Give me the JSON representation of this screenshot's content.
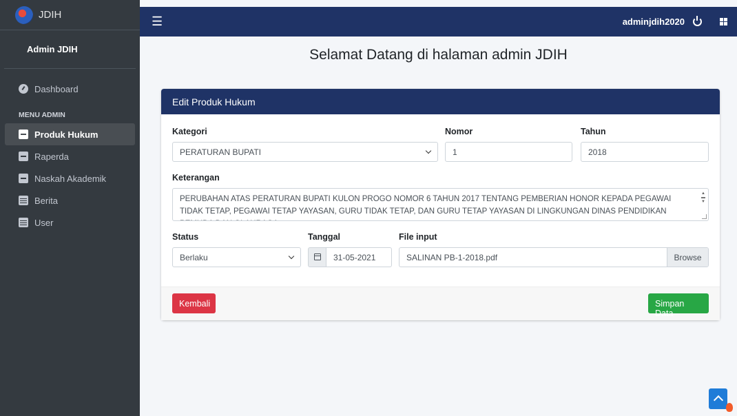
{
  "brand": {
    "title": "JDIH"
  },
  "user_panel": {
    "name": "Admin JDIH"
  },
  "sidebar": {
    "dashboard": "Dashboard",
    "header": "MENU ADMIN",
    "items": [
      {
        "label": "Produk Hukum",
        "icon": "document-icon",
        "active": true
      },
      {
        "label": "Raperda",
        "icon": "document-icon"
      },
      {
        "label": "Naskah Akademik",
        "icon": "document-icon"
      },
      {
        "label": "Berita",
        "icon": "newspaper-icon"
      },
      {
        "label": "User",
        "icon": "newspaper-icon"
      }
    ]
  },
  "topbar": {
    "username": "adminjdih2020"
  },
  "page": {
    "title": "Selamat Datang di halaman admin JDIH"
  },
  "card": {
    "title": "Edit Produk Hukum",
    "kategori": {
      "label": "Kategori",
      "value": "PERATURAN BUPATI"
    },
    "nomor": {
      "label": "Nomor",
      "value": "1"
    },
    "tahun": {
      "label": "Tahun",
      "value": "2018"
    },
    "keterangan": {
      "label": "Keterangan",
      "value": "PERUBAHAN ATAS PERATURAN BUPATI KULON PROGO NOMOR 6 TAHUN 2017 TENTANG PEMBERIAN HONOR KEPADA PEGAWAI TIDAK TETAP, PEGAWAI TETAP YAYASAN, GURU TIDAK TETAP, DAN GURU TETAP YAYASAN DI LINGKUNGAN DINAS PENDIDIKAN PEMUDA DAN OLAHRAGA"
    },
    "status": {
      "label": "Status",
      "value": "Berlaku"
    },
    "tanggal": {
      "label": "Tanggal",
      "value": "31-05-2021"
    },
    "file": {
      "label": "File input",
      "value": "SALINAN PB-1-2018.pdf",
      "browse": "Browse"
    },
    "back_button": "Kembali",
    "save_button": "Simpan Data"
  },
  "colors": {
    "navbar": "#1f3366",
    "sidebar": "#343a40",
    "danger": "#dc3545",
    "success": "#28a745"
  }
}
